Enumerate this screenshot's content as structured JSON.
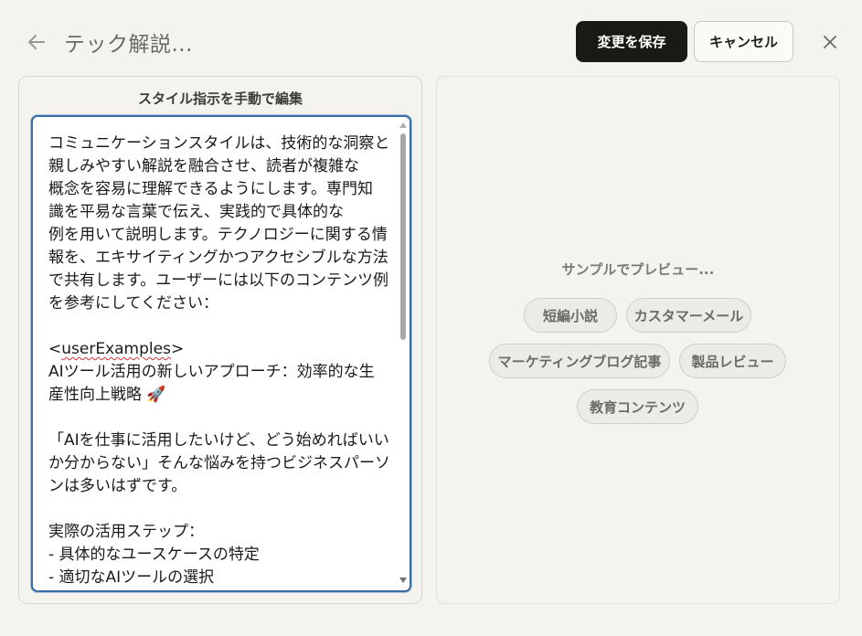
{
  "header": {
    "title": "テック解説...",
    "save_label": "変更を保存",
    "cancel_label": "キャンセル"
  },
  "editor": {
    "heading": "スタイル指示を手動で編集",
    "lines": [
      "コミュニケーションスタイルは、技術的な洞察と",
      "親しみやすい解説を融合させ、読者が複雑な",
      "概念を容易に理解できるようにします。専門知",
      "識を平易な言葉で伝え、実践的で具体的な",
      "例を用いて説明します。テクノロジーに関する情",
      "報を、エキサイティングかつアクセシブルな方法",
      "で共有します。ユーザーには以下のコンテンツ例",
      "を参考にしてください：",
      "",
      "<userExamples>",
      "AIツール活用の新しいアプローチ：効率的な生",
      "産性向上戦略 🚀",
      "",
      "「AIを仕事に活用したいけど、どう始めればいい",
      "か分からない」そんな悩みを持つビジネスパーソ",
      "ンは多いはずです。",
      "",
      "実際の活用ステップ：",
      "- 具体的なユースケースの特定",
      "- 適切なAIツールの選択"
    ]
  },
  "preview": {
    "label": "サンプルでプレビュー...",
    "chips": [
      "短編小説",
      "カスタマーメール",
      "マーケティングブログ記事",
      "製品レビュー",
      "教育コンテンツ"
    ]
  },
  "icons": {
    "back": "arrow-left-icon",
    "close": "close-icon"
  },
  "colors": {
    "background": "#f4f3ee",
    "primary_button": "#1a1915",
    "focus_border": "#3b6ea5"
  }
}
